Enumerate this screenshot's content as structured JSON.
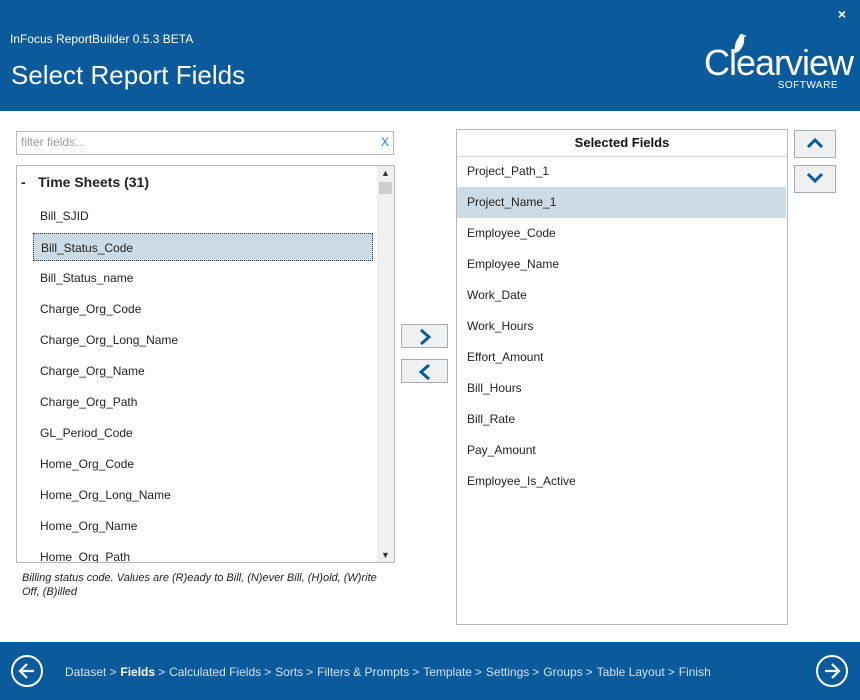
{
  "window": {
    "app_title": "InFocus ReportBuilder 0.5.3 BETA",
    "page_title": "Select Report Fields",
    "close_label": "×"
  },
  "logo": {
    "word": "Clearview",
    "sub": "SOFTWARE"
  },
  "filter": {
    "placeholder": "filter fields...",
    "value": "",
    "clear_label": "X"
  },
  "available": {
    "group_toggle": "-",
    "group_label": "Time Sheets (31)",
    "fields": [
      "Bill_SJID",
      "Bill_Status_Code",
      "Bill_Status_name",
      "Charge_Org_Code",
      "Charge_Org_Long_Name",
      "Charge_Org_Name",
      "Charge_Org_Path",
      "GL_Period_Code",
      "Home_Org_Code",
      "Home_Org_Long_Name",
      "Home_Org_Name",
      "Home_Org_Path"
    ],
    "selected_field": "Bill_Status_Code"
  },
  "description": "Billing status code.  Values are (R)eady to Bill, (N)ever Bill, (H)old, (W)rite Off, (B)illed",
  "selected": {
    "header": "Selected Fields",
    "fields": [
      "Project_Path_1",
      "Project_Name_1",
      "Employee_Code",
      "Employee_Name",
      "Work_Date",
      "Work_Hours",
      "Effort_Amount",
      "Bill_Hours",
      "Bill_Rate",
      "Pay_Amount",
      "Employee_Is_Active"
    ],
    "selected_field": "Project_Name_1"
  },
  "nav": {
    "steps": [
      "Dataset",
      "Fields",
      "Calculated Fields",
      "Sorts",
      "Filters & Prompts",
      "Template",
      "Settings",
      "Groups",
      "Table Layout",
      "Finish"
    ],
    "current": "Fields",
    "separator": ">"
  },
  "colors": {
    "brand": "#0a5a9c",
    "selection": "#ccdbe6"
  }
}
